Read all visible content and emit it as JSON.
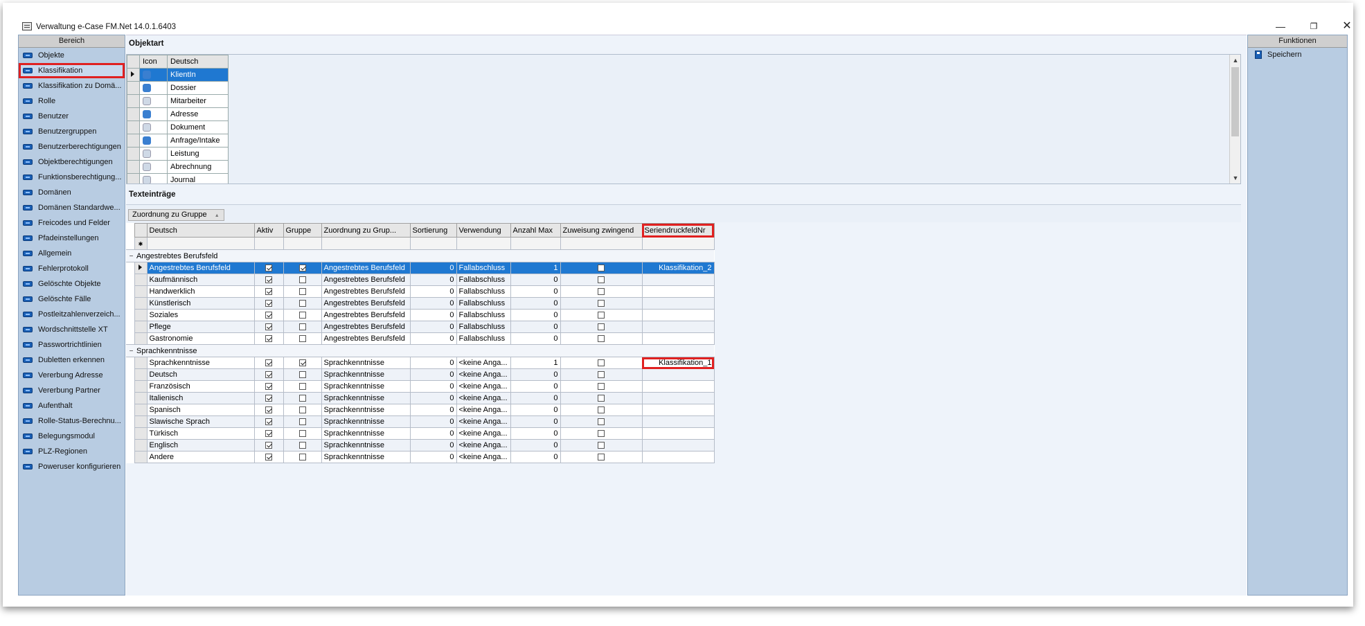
{
  "window": {
    "title": "Verwaltung e-Case FM.Net 14.0.1.6403"
  },
  "left_panel": {
    "header": "Bereich",
    "items": [
      "Objekte",
      "Klassifikation",
      "Klassifikation zu Domä...",
      "Rolle",
      "Benutzer",
      "Benutzergruppen",
      "Benutzerberechtigungen",
      "Objektberechtigungen",
      "Funktionsberechtigung...",
      "Domänen",
      "Domänen Standardwe...",
      "Freicodes und Felder",
      "Pfadeinstellungen",
      "Allgemein",
      "Fehlerprotokoll",
      "Gelöschte Objekte",
      "Gelöschte Fälle",
      "Postleitzahlenverzeich...",
      "Wordschnittstelle XT",
      "Passwortrichtlinien",
      "Dubletten erkennen",
      "Vererbung Adresse",
      "Vererbung Partner",
      "Aufenthalt",
      "Rolle-Status-Berechnu...",
      "Belegungsmodul",
      "PLZ-Regionen",
      "Poweruser konfigurieren"
    ],
    "selected_index": 1
  },
  "right_panel": {
    "header": "Funktionen",
    "save_label": "Speichern"
  },
  "objektart": {
    "title": "Objektart",
    "columns": [
      "Icon",
      "Deutsch"
    ],
    "rows": [
      "KlientIn",
      "Dossier",
      "Mitarbeiter",
      "Adresse",
      "Dokument",
      "Anfrage/Intake",
      "Leistung",
      "Abrechnung",
      "Journal"
    ],
    "selected_index": 0
  },
  "texteintraege": {
    "title": "Texteinträge",
    "group_chip": "Zuordnung zu Gruppe",
    "columns": [
      "Deutsch",
      "Aktiv",
      "Gruppe",
      "Zuordnung zu Grup...",
      "Sortierung",
      "Verwendung",
      "Anzahl Max",
      "Zuweisung zwingend",
      "SeriendruckfeldNr"
    ],
    "groups": [
      {
        "name": "Angestrebtes Berufsfeld",
        "rows": [
          {
            "deutsch": "Angestrebtes Berufsfeld",
            "aktiv": true,
            "gruppe": true,
            "zuordnung": "Angestrebtes Berufsfeld",
            "sortierung": "0",
            "verwendung": "Fallabschluss",
            "anzahl": "1",
            "zwingend": false,
            "serien": "Klassifikation_2",
            "selected": true
          },
          {
            "deutsch": "Kaufmännisch",
            "aktiv": true,
            "gruppe": false,
            "zuordnung": "Angestrebtes Berufsfeld",
            "sortierung": "0",
            "verwendung": "Fallabschluss",
            "anzahl": "0",
            "zwingend": false,
            "serien": ""
          },
          {
            "deutsch": "Handwerklich",
            "aktiv": true,
            "gruppe": false,
            "zuordnung": "Angestrebtes Berufsfeld",
            "sortierung": "0",
            "verwendung": "Fallabschluss",
            "anzahl": "0",
            "zwingend": false,
            "serien": ""
          },
          {
            "deutsch": "Künstlerisch",
            "aktiv": true,
            "gruppe": false,
            "zuordnung": "Angestrebtes Berufsfeld",
            "sortierung": "0",
            "verwendung": "Fallabschluss",
            "anzahl": "0",
            "zwingend": false,
            "serien": ""
          },
          {
            "deutsch": "Soziales",
            "aktiv": true,
            "gruppe": false,
            "zuordnung": "Angestrebtes Berufsfeld",
            "sortierung": "0",
            "verwendung": "Fallabschluss",
            "anzahl": "0",
            "zwingend": false,
            "serien": ""
          },
          {
            "deutsch": "Pflege",
            "aktiv": true,
            "gruppe": false,
            "zuordnung": "Angestrebtes Berufsfeld",
            "sortierung": "0",
            "verwendung": "Fallabschluss",
            "anzahl": "0",
            "zwingend": false,
            "serien": ""
          },
          {
            "deutsch": "Gastronomie",
            "aktiv": true,
            "gruppe": false,
            "zuordnung": "Angestrebtes Berufsfeld",
            "sortierung": "0",
            "verwendung": "Fallabschluss",
            "anzahl": "0",
            "zwingend": false,
            "serien": ""
          }
        ]
      },
      {
        "name": "Sprachkenntnisse",
        "rows": [
          {
            "deutsch": "Sprachkenntnisse",
            "aktiv": true,
            "gruppe": true,
            "zuordnung": "Sprachkenntnisse",
            "sortierung": "0",
            "verwendung": "<keine Anga...",
            "anzahl": "1",
            "zwingend": false,
            "serien": "Klassifikation_1",
            "highlight": true
          },
          {
            "deutsch": "Deutsch",
            "aktiv": true,
            "gruppe": false,
            "zuordnung": "Sprachkenntnisse",
            "sortierung": "0",
            "verwendung": "<keine Anga...",
            "anzahl": "0",
            "zwingend": false,
            "serien": ""
          },
          {
            "deutsch": "Französisch",
            "aktiv": true,
            "gruppe": false,
            "zuordnung": "Sprachkenntnisse",
            "sortierung": "0",
            "verwendung": "<keine Anga...",
            "anzahl": "0",
            "zwingend": false,
            "serien": ""
          },
          {
            "deutsch": "Italienisch",
            "aktiv": true,
            "gruppe": false,
            "zuordnung": "Sprachkenntnisse",
            "sortierung": "0",
            "verwendung": "<keine Anga...",
            "anzahl": "0",
            "zwingend": false,
            "serien": ""
          },
          {
            "deutsch": "Spanisch",
            "aktiv": true,
            "gruppe": false,
            "zuordnung": "Sprachkenntnisse",
            "sortierung": "0",
            "verwendung": "<keine Anga...",
            "anzahl": "0",
            "zwingend": false,
            "serien": ""
          },
          {
            "deutsch": "Slawische Sprach",
            "aktiv": true,
            "gruppe": false,
            "zuordnung": "Sprachkenntnisse",
            "sortierung": "0",
            "verwendung": "<keine Anga...",
            "anzahl": "0",
            "zwingend": false,
            "serien": ""
          },
          {
            "deutsch": "Türkisch",
            "aktiv": true,
            "gruppe": false,
            "zuordnung": "Sprachkenntnisse",
            "sortierung": "0",
            "verwendung": "<keine Anga...",
            "anzahl": "0",
            "zwingend": false,
            "serien": ""
          },
          {
            "deutsch": "Englisch",
            "aktiv": true,
            "gruppe": false,
            "zuordnung": "Sprachkenntnisse",
            "sortierung": "0",
            "verwendung": "<keine Anga...",
            "anzahl": "0",
            "zwingend": false,
            "serien": ""
          },
          {
            "deutsch": "Andere",
            "aktiv": true,
            "gruppe": false,
            "zuordnung": "Sprachkenntnisse",
            "sortierung": "0",
            "verwendung": "<keine Anga...",
            "anzahl": "0",
            "zwingend": false,
            "serien": ""
          }
        ]
      }
    ]
  },
  "colors": {
    "accent": "#1f78d1",
    "highlight_box": "#e02020",
    "panel": "#b8cce2"
  }
}
